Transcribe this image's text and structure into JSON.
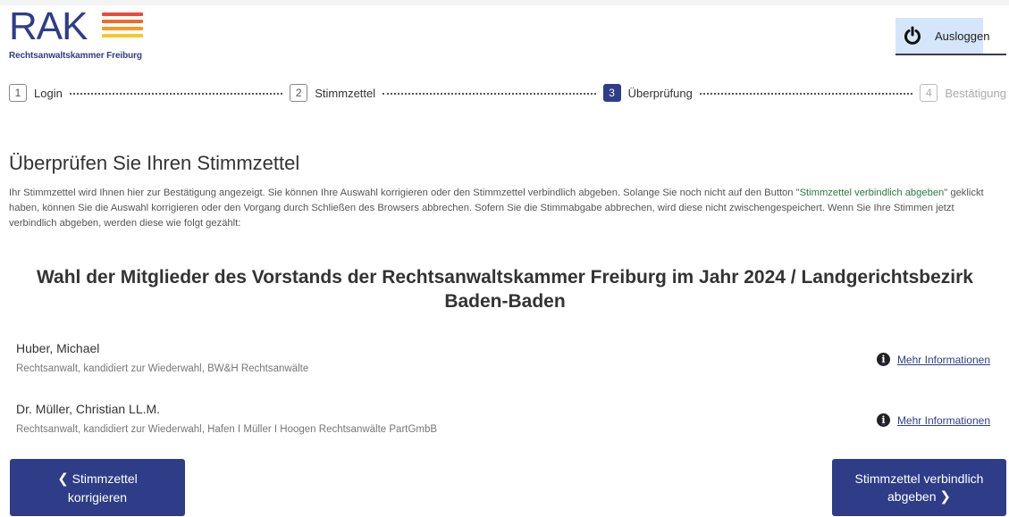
{
  "logo": {
    "letters": "RAK",
    "subtitle": "Rechtsanwaltskammer Freiburg",
    "bar_colors": [
      "#e94b3c",
      "#f26a2a",
      "#f59a23",
      "#f7c72d"
    ]
  },
  "header": {
    "logout_label": "Ausloggen",
    "logout_icon": "power-icon"
  },
  "steps": [
    {
      "number": "1",
      "label": "Login",
      "state": "done"
    },
    {
      "number": "2",
      "label": "Stimmzettel",
      "state": "done"
    },
    {
      "number": "3",
      "label": "Überprüfung",
      "state": "active"
    },
    {
      "number": "4",
      "label": "Bestätigung",
      "state": "disabled"
    }
  ],
  "main": {
    "title": "Überprüfen Sie Ihren Stimmzettel",
    "intro_part1": "Ihr Stimmzettel wird Ihnen hier zur Bestätigung angezeigt. Sie können Ihre Auswahl korrigieren oder den Stimmzettel verbindlich abgeben. Solange Sie noch nicht auf den Button \"",
    "intro_link": "Stimmzettel verbindlich abgeben",
    "intro_part2": "\" geklickt haben, können Sie die Auswahl korrigieren oder den Vorgang durch Schließen des Browsers abbrechen. Sofern Sie die Stimmabgabe abbrechen, wird diese nicht zwischengespeichert. Wenn Sie Ihre Stimmen jetzt verbindlich abgeben, werden diese wie folgt gezählt:",
    "ballot_title": "Wahl der Mitglieder des Vorstands der Rechtsanwaltskammer Freiburg im Jahr 2024 / Landgerichtsbezirk Baden-Baden"
  },
  "candidates": [
    {
      "name": "Huber, Michael",
      "description": "Rechtsanwalt, kandidiert zur Wiederwahl, BW&H Rechtsanwälte",
      "more_info": "Mehr Informationen"
    },
    {
      "name": "Dr. Müller, Christian LL.M.",
      "description": "Rechtsanwalt, kandidiert zur Wiederwahl, Hafen I Müller I Hoogen Rechtsanwälte PartGmbB",
      "more_info": "Mehr Informationen"
    }
  ],
  "buttons": {
    "correct_line1": "Stimmzettel",
    "correct_line2": "korrigieren",
    "submit_line1": "Stimmzettel verbindlich",
    "submit_line2": "abgeben"
  },
  "colors": {
    "brand": "#2f3d88",
    "link_green": "#2a7a3e",
    "logout_highlight": "#d5e6fb"
  }
}
